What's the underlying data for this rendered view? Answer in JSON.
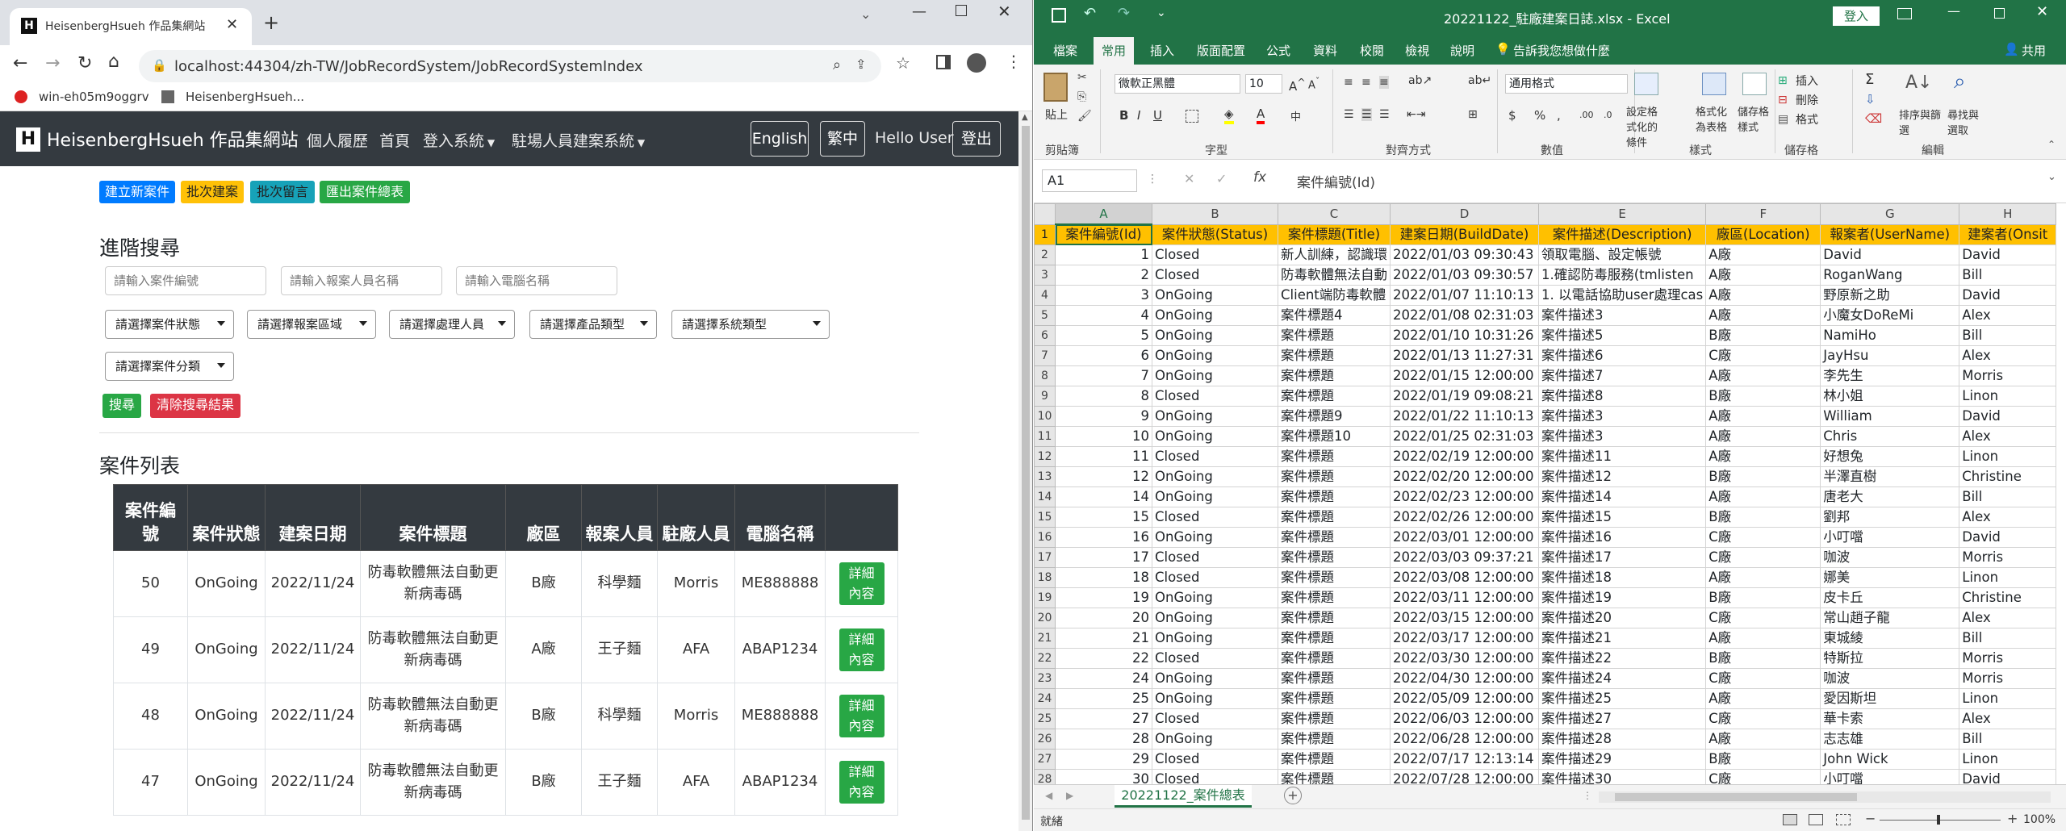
{
  "browser": {
    "tab_title": "HeisenbergHsueh 作品集網站",
    "url": "localhost:44304/zh-TW/JobRecordSystem/JobRecordSystemIndex",
    "bookmarks": [
      "win-eh05m9oggrv",
      "HeisenbergHsueh..."
    ]
  },
  "site": {
    "brand": "HeisenbergHsueh 作品集網站",
    "nav": [
      "個人履歷",
      "首頁",
      "登入系統",
      "駐場人員建案系統"
    ],
    "lang_en": "English",
    "lang_zh": "繁中",
    "hello": "Hello User",
    "logout": "登出"
  },
  "actions": {
    "create": "建立新案件",
    "batch_create": "批次建案",
    "batch_comment": "批次留言",
    "export": "匯出案件總表"
  },
  "search": {
    "title": "進階搜尋",
    "ph_case_id": "請輸入案件編號",
    "ph_user": "請輸入報案人員名稱",
    "ph_pc": "請輸入電腦名稱",
    "selects": [
      "請選擇案件狀態",
      "請選擇報案區域",
      "請選擇處理人員",
      "請選擇產品類型",
      "請選擇系統類型",
      "請選擇案件分類"
    ],
    "search_btn": "搜尋",
    "clear_btn": "清除搜尋結果"
  },
  "case_list": {
    "title": "案件列表",
    "headers": [
      "案件編號",
      "案件狀態",
      "建案日期",
      "案件標題",
      "廠區",
      "報案人員",
      "駐廠人員",
      "電腦名稱",
      ""
    ],
    "detail_label": "詳細內容",
    "rows": [
      [
        "50",
        "OnGoing",
        "2022/11/24",
        "防毒軟體無法自動更新病毒碼",
        "B廠",
        "科學麵",
        "Morris",
        "ME888888"
      ],
      [
        "49",
        "OnGoing",
        "2022/11/24",
        "防毒軟體無法自動更新病毒碼",
        "A廠",
        "王子麵",
        "AFA",
        "ABAP1234"
      ],
      [
        "48",
        "OnGoing",
        "2022/11/24",
        "防毒軟體無法自動更新病毒碼",
        "B廠",
        "科學麵",
        "Morris",
        "ME888888"
      ],
      [
        "47",
        "OnGoing",
        "2022/11/24",
        "防毒軟體無法自動更新病毒碼",
        "B廠",
        "王子麵",
        "AFA",
        "ABAP1234"
      ]
    ]
  },
  "excel": {
    "title": "20221122_駐廠建案日誌.xlsx - Excel",
    "login": "登入",
    "share": "共用",
    "tabs": [
      "檔案",
      "常用",
      "插入",
      "版面配置",
      "公式",
      "資料",
      "校閱",
      "檢視",
      "說明",
      "告訴我您想做什麼"
    ],
    "font_name": "微軟正黑體",
    "font_size": "10",
    "number_format": "通用格式",
    "group_labels": [
      "剪貼簿",
      "字型",
      "對齊方式",
      "數值",
      "樣式",
      "儲存格",
      "編輯"
    ],
    "ribbon_items": {
      "paste": "貼上",
      "cond_format": "設定格式化的條件",
      "format_table": "格式化為表格",
      "cell_style": "儲存格樣式",
      "insert": "插入",
      "delete": "刪除",
      "format": "格式",
      "sort": "排序與篩選",
      "find": "尋找與選取"
    },
    "name_box": "A1",
    "formula": "案件編號(Id)",
    "col_letters": [
      "A",
      "B",
      "C",
      "D",
      "E",
      "F",
      "G",
      "H"
    ],
    "headers": [
      "案件編號(Id)",
      "案件狀態(Status)",
      "案件標題(Title)",
      "建案日期(BuildDate)",
      "案件描述(Description)",
      "廠區(Location)",
      "報案者(UserName)",
      "建案者(Onsit"
    ],
    "rows": [
      [
        "1",
        "Closed",
        "新人訓練，認識環",
        "2022/01/03 09:30:43",
        "領取電腦、設定帳號",
        "A廠",
        "David",
        "David"
      ],
      [
        "2",
        "Closed",
        "防毒軟體無法自動",
        "2022/01/03 09:30:57",
        "1.確認防毒服務(tmlisten",
        "A廠",
        "RoganWang",
        "Bill"
      ],
      [
        "3",
        "OnGoing",
        "Client端防毒軟體",
        "2022/01/07 11:10:13",
        "1. 以電話協助user處理cas",
        "A廠",
        "野原新之助",
        "David"
      ],
      [
        "4",
        "OnGoing",
        "案件標題4",
        "2022/01/08 02:31:03",
        "案件描述3",
        "A廠",
        "小魔女DoReMi",
        "Alex"
      ],
      [
        "5",
        "OnGoing",
        "案件標題",
        "2022/01/10 10:31:26",
        "案件描述5",
        "B廠",
        "NamiHo",
        "Bill"
      ],
      [
        "6",
        "OnGoing",
        "案件標題",
        "2022/01/13 11:27:31",
        "案件描述6",
        "C廠",
        "JayHsu",
        "Alex"
      ],
      [
        "7",
        "OnGoing",
        "案件標題",
        "2022/01/15 12:00:00",
        "案件描述7",
        "A廠",
        "李先生",
        "Morris"
      ],
      [
        "8",
        "Closed",
        "案件標題",
        "2022/01/19 09:08:21",
        "案件描述8",
        "B廠",
        "林小姐",
        "Linon"
      ],
      [
        "9",
        "OnGoing",
        "案件標題9",
        "2022/01/22 11:10:13",
        "案件描述3",
        "A廠",
        "William",
        "David"
      ],
      [
        "10",
        "OnGoing",
        "案件標題10",
        "2022/01/25 02:31:03",
        "案件描述3",
        "A廠",
        "Chris",
        "Alex"
      ],
      [
        "11",
        "Closed",
        "案件標題",
        "2022/02/19 12:00:00",
        "案件描述11",
        "A廠",
        "好想兔",
        "Linon"
      ],
      [
        "12",
        "OnGoing",
        "案件標題",
        "2022/02/20 12:00:00",
        "案件描述12",
        "B廠",
        "半澤直樹",
        "Christine"
      ],
      [
        "14",
        "OnGoing",
        "案件標題",
        "2022/02/23 12:00:00",
        "案件描述14",
        "A廠",
        "唐老大",
        "Bill"
      ],
      [
        "15",
        "Closed",
        "案件標題",
        "2022/02/26 12:00:00",
        "案件描述15",
        "B廠",
        "劉邦",
        "Alex"
      ],
      [
        "16",
        "OnGoing",
        "案件標題",
        "2022/03/01 12:00:00",
        "案件描述16",
        "C廠",
        "小叮噹",
        "David"
      ],
      [
        "17",
        "Closed",
        "案件標題",
        "2022/03/03 09:37:21",
        "案件描述17",
        "C廠",
        "咖波",
        "Morris"
      ],
      [
        "18",
        "Closed",
        "案件標題",
        "2022/03/08 12:00:00",
        "案件描述18",
        "A廠",
        "娜美",
        "Linon"
      ],
      [
        "19",
        "OnGoing",
        "案件標題",
        "2022/03/11 12:00:00",
        "案件描述19",
        "B廠",
        "皮卡丘",
        "Christine"
      ],
      [
        "20",
        "OnGoing",
        "案件標題",
        "2022/03/15 12:00:00",
        "案件描述20",
        "C廠",
        "常山趙子龍",
        "Alex"
      ],
      [
        "21",
        "OnGoing",
        "案件標題",
        "2022/03/17 12:00:00",
        "案件描述21",
        "A廠",
        "東城綾",
        "Bill"
      ],
      [
        "22",
        "Closed",
        "案件標題",
        "2022/03/30 12:00:00",
        "案件描述22",
        "B廠",
        "特斯拉",
        "Morris"
      ],
      [
        "24",
        "OnGoing",
        "案件標題",
        "2022/04/30 12:00:00",
        "案件描述24",
        "C廠",
        "咖波",
        "Morris"
      ],
      [
        "25",
        "OnGoing",
        "案件標題",
        "2022/05/09 12:00:00",
        "案件描述25",
        "A廠",
        "愛因斯坦",
        "Linon"
      ],
      [
        "27",
        "Closed",
        "案件標題",
        "2022/06/03 12:00:00",
        "案件描述27",
        "C廠",
        "華卡索",
        "Alex"
      ],
      [
        "28",
        "OnGoing",
        "案件標題",
        "2022/06/28 12:00:00",
        "案件描述28",
        "A廠",
        "志志雄",
        "Bill"
      ],
      [
        "29",
        "Closed",
        "案件標題",
        "2022/07/17 12:13:14",
        "案件描述29",
        "B廠",
        "John Wick",
        "Linon"
      ],
      [
        "30",
        "Closed",
        "案件標題",
        "2022/07/28 12:00:00",
        "案件描述30",
        "C廠",
        "小叮噹",
        "David"
      ]
    ],
    "sheet_tab": "20221122_案件總表",
    "status_ready": "就緒",
    "zoom": "100%"
  }
}
